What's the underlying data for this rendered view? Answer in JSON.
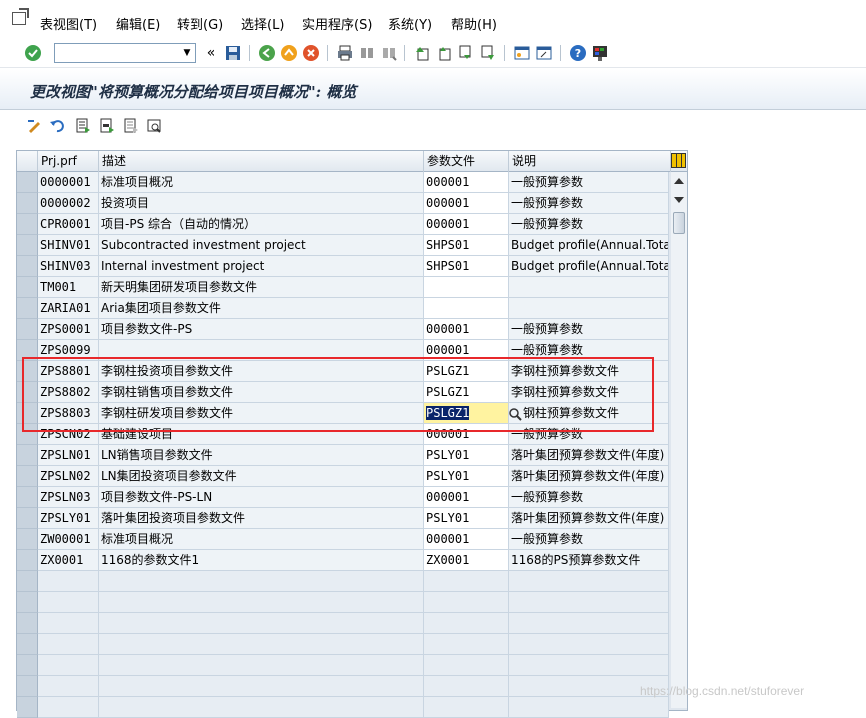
{
  "menu": {
    "items": [
      "表视图(T)",
      "编辑(E)",
      "转到(G)",
      "选择(L)",
      "实用程序(S)",
      "系统(Y)",
      "帮助(H)"
    ]
  },
  "toolbar": {
    "command_value": "",
    "icons": [
      "check-icon",
      "save-icon",
      "back-icon",
      "exit-icon",
      "cancel-icon",
      "print-icon",
      "find-icon",
      "find-next-icon",
      "first-page-icon",
      "prev-page-icon",
      "next-page-icon",
      "last-page-icon",
      "new-session-icon",
      "shortcut-icon",
      "help-icon",
      "customize-layout-icon"
    ]
  },
  "title": "更改视图\"将预算概况分配给项目项目概况\": 概览",
  "app_toolbar": {
    "icons": [
      "display-change-icon",
      "undo-icon",
      "select-all-icon",
      "select-block-icon",
      "deselect-all-icon",
      "selection-criteria-icon"
    ]
  },
  "table": {
    "columns": [
      "Prj.prf",
      "描述",
      "参数文件",
      "说明"
    ],
    "rows": [
      {
        "prf": "0000001",
        "desc": "标准项目概况",
        "param": "000001",
        "expl": "一般预算参数"
      },
      {
        "prf": "0000002",
        "desc": "投资项目",
        "param": "000001",
        "expl": "一般预算参数"
      },
      {
        "prf": "CPR0001",
        "desc": "项目-PS 综合（自动的情况）",
        "param": "000001",
        "expl": "一般预算参数"
      },
      {
        "prf": "SHINV01",
        "desc": "Subcontracted investment project",
        "param": "SHPS01",
        "expl": "Budget profile(Annual.Total)"
      },
      {
        "prf": "SHINV03",
        "desc": "Internal investment project",
        "param": "SHPS01",
        "expl": "Budget profile(Annual.Total)"
      },
      {
        "prf": "TM001",
        "desc": "新天明集团研发项目参数文件",
        "param": "",
        "expl": ""
      },
      {
        "prf": "ZARIA01",
        "desc": "Aria集团项目参数文件",
        "param": "",
        "expl": ""
      },
      {
        "prf": "ZPS0001",
        "desc": "项目参数文件-PS",
        "param": "000001",
        "expl": "一般预算参数"
      },
      {
        "prf": "ZPS0099",
        "desc": "",
        "param": "000001",
        "expl": "一般预算参数"
      },
      {
        "prf": "ZPS8801",
        "desc": "李钢柱投资项目参数文件",
        "param": "PSLGZ1",
        "expl": "李钢柱预算参数文件"
      },
      {
        "prf": "ZPS8802",
        "desc": "李钢柱销售项目参数文件",
        "param": "PSLGZ1",
        "expl": "李钢柱预算参数文件"
      },
      {
        "prf": "ZPS8803",
        "desc": "李钢柱研发项目参数文件",
        "param": "PSLGZ1",
        "expl": "钢柱预算参数文件"
      },
      {
        "prf": "ZPSCN02",
        "desc": "基础建设项目",
        "param": "000001",
        "expl": "一般预算参数"
      },
      {
        "prf": "ZPSLN01",
        "desc": "LN销售项目参数文件",
        "param": "PSLY01",
        "expl": "落叶集团预算参数文件(年度)"
      },
      {
        "prf": "ZPSLN02",
        "desc": "LN集团投资项目参数文件",
        "param": "PSLY01",
        "expl": "落叶集团预算参数文件(年度)"
      },
      {
        "prf": "ZPSLN03",
        "desc": "项目参数文件-PS-LN",
        "param": "000001",
        "expl": "一般预算参数"
      },
      {
        "prf": "ZPSLY01",
        "desc": "落叶集团投资项目参数文件",
        "param": "PSLY01",
        "expl": "落叶集团预算参数文件(年度)"
      },
      {
        "prf": "ZW00001",
        "desc": "标准项目概况",
        "param": "000001",
        "expl": "一般预算参数"
      },
      {
        "prf": "ZX0001",
        "desc": "1168的参数文件1",
        "param": "ZX0001",
        "expl": "1168的PS预算参数文件"
      }
    ],
    "active_row_index": 11
  },
  "watermark": "https://blog.csdn.net/stuforever",
  "colors": {
    "annotation": "#e8282b",
    "selected_text_bg": "#0a246a",
    "active_cell_bg": "#fff3a0"
  }
}
